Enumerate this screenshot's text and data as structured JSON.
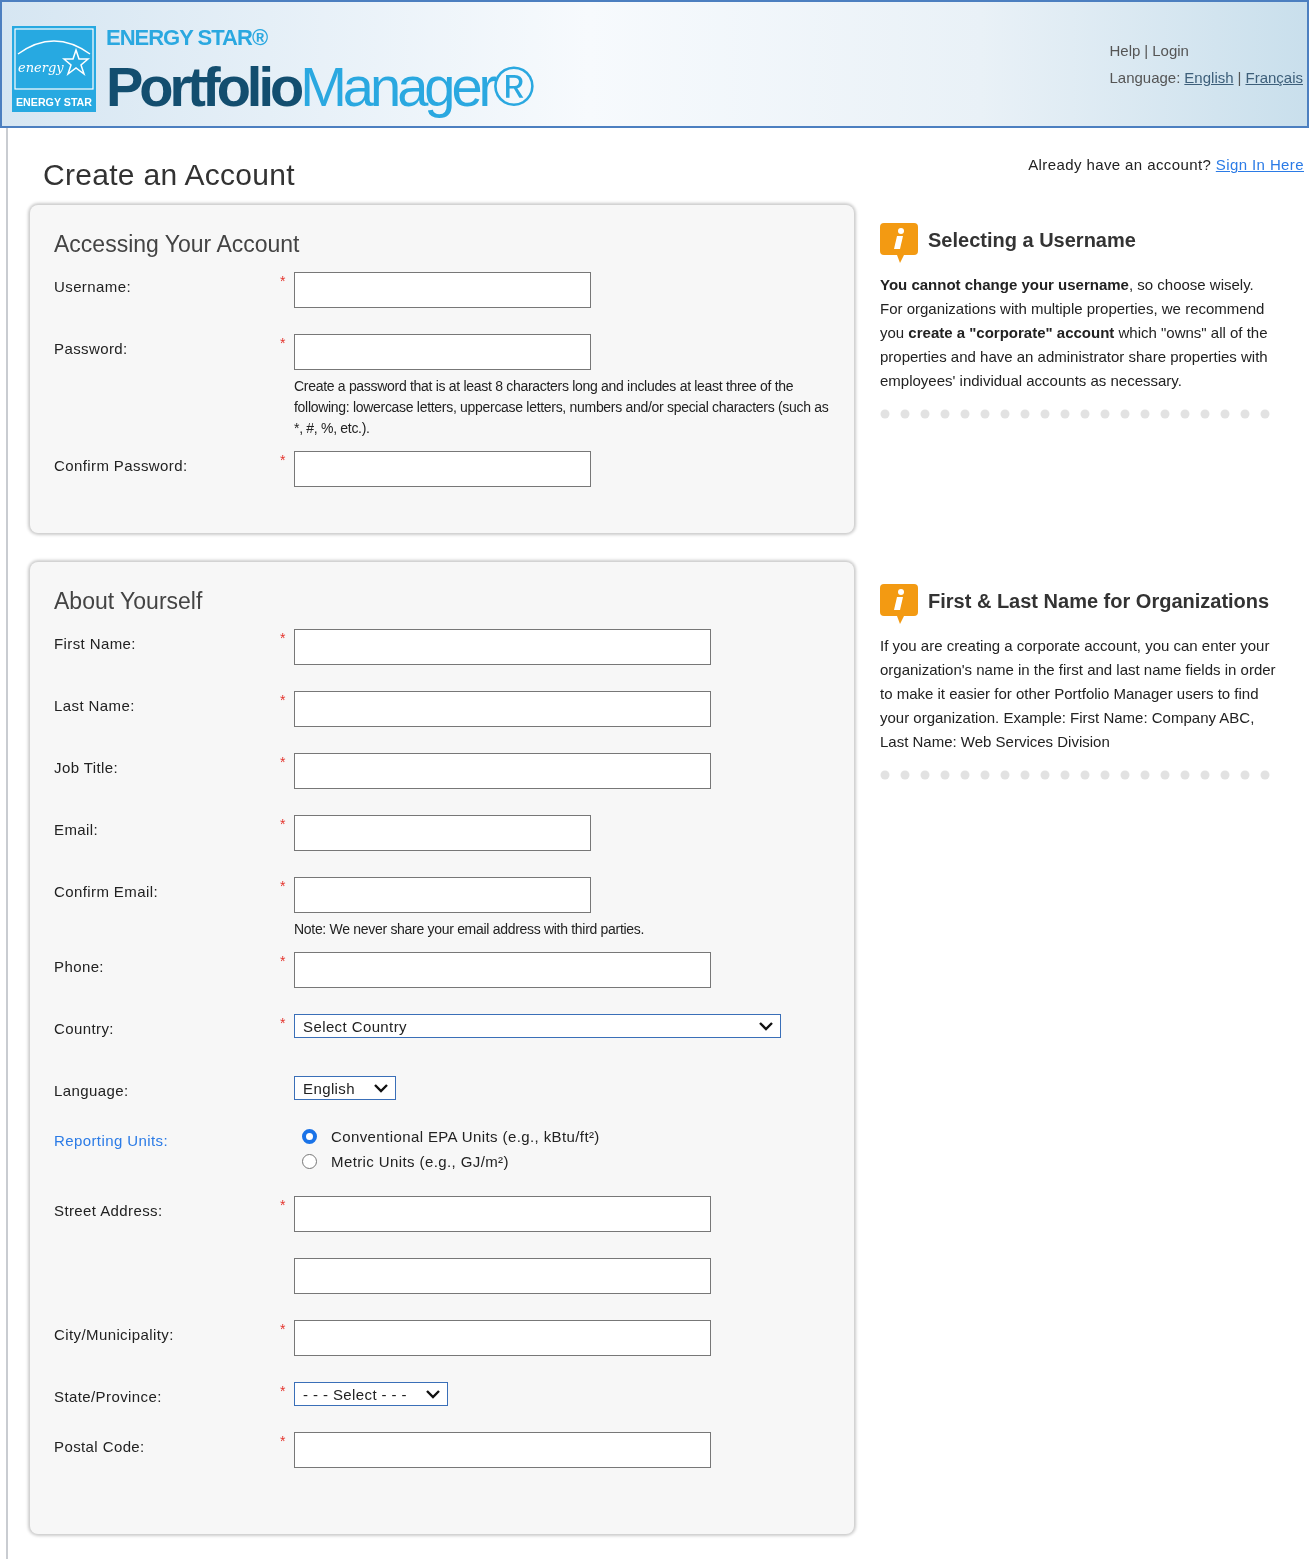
{
  "header": {
    "logo_script": "energy",
    "logo_label": "ENERGY STAR",
    "brand_top": "ENERGY STAR®",
    "brand_strong": "Portfolio",
    "brand_light": "Manager®",
    "separator": "|",
    "top_links": [
      {
        "label": "Help"
      },
      {
        "label": "Login"
      }
    ],
    "language_label": "Language:",
    "languages": [
      {
        "label": "English"
      },
      {
        "label": "Français"
      }
    ]
  },
  "page": {
    "title": "Create an Account",
    "signin_prompt": "Already have an account?",
    "signin_link": "Sign In Here",
    "required_mark": "*"
  },
  "sections": [
    {
      "title": "Accessing Your Account",
      "fields": [
        {
          "label": "Username:",
          "kind": "short",
          "required": true
        },
        {
          "label": "Password:",
          "kind": "short",
          "required": true,
          "note": "Create a password that is at least 8 characters long and includes at least three of the following: lowercase letters, uppercase letters, numbers and/or special characters (such as *, #, %, etc.)."
        },
        {
          "label": "Confirm Password:",
          "kind": "short",
          "required": true
        }
      ]
    },
    {
      "title": "About Yourself",
      "fields": [
        {
          "label": "First Name:",
          "kind": "long",
          "required": true
        },
        {
          "label": "Last Name:",
          "kind": "long",
          "required": true
        },
        {
          "label": "Job Title:",
          "kind": "long",
          "required": true
        },
        {
          "label": "Email:",
          "kind": "short",
          "required": true
        },
        {
          "label": "Confirm Email:",
          "kind": "short",
          "required": true,
          "note": "Note: We never share your email address with third parties."
        },
        {
          "label": "Phone:",
          "kind": "long",
          "required": true
        },
        {
          "label": "Country:",
          "kind": "wideselect",
          "required": true,
          "value": "Select Country"
        },
        {
          "label": "Language:",
          "kind": "select",
          "required": false,
          "value": "English"
        },
        {
          "label": "Reporting Units:",
          "kind": "radios",
          "required": false,
          "label_link": true,
          "options": [
            {
              "label": "Conventional EPA Units (e.g., kBtu/ft²)",
              "selected": true
            },
            {
              "label": "Metric Units (e.g., GJ/m²)",
              "selected": false
            }
          ]
        },
        {
          "label": "Street Address:",
          "kind": "long",
          "required": true
        },
        {
          "kind": "long",
          "required": false
        },
        {
          "label": "City/Municipality:",
          "kind": "long",
          "required": true
        },
        {
          "label": "State/Province:",
          "kind": "select",
          "required": true,
          "value": "- - - Select - - -"
        },
        {
          "label": "Postal Code:",
          "kind": "long",
          "required": true
        }
      ]
    }
  ],
  "tips": [
    {
      "title": "Selecting a Username",
      "text": "**You cannot change your username**, so choose wisely. For organizations with multiple properties, we recommend you **create a \"corporate\" account** which \"owns\" all of the properties and have an administrator share properties with employees' individual accounts as necessary."
    },
    {
      "title": "First & Last Name for Organizations",
      "text": "If you are creating a corporate account, you can enter your organization's name in the first and last name fields in order to make it easier for other Portfolio Manager users to find your organization. Example: First Name: Company ABC, Last Name: Web Services Division"
    }
  ]
}
